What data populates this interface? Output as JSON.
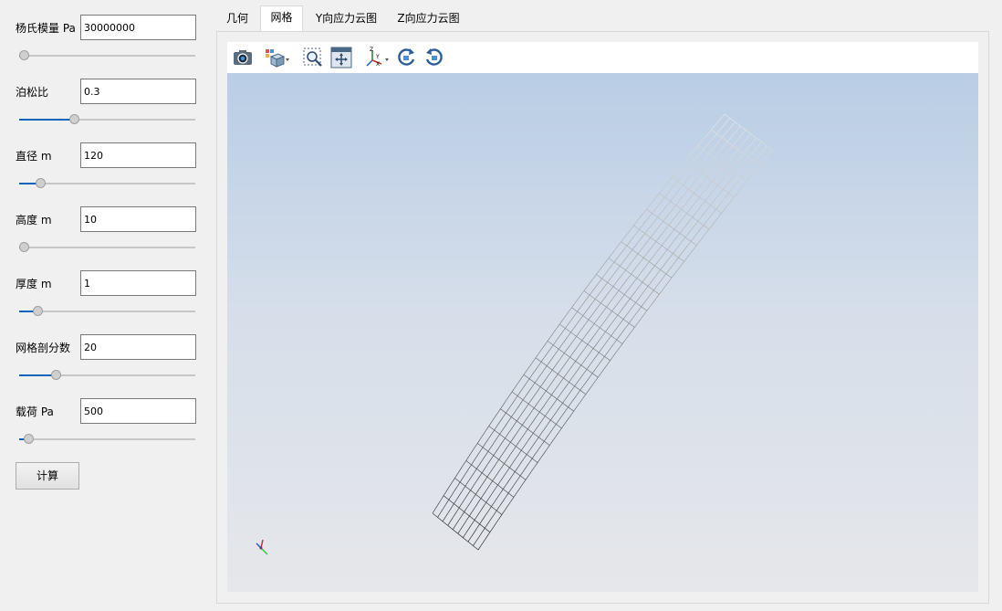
{
  "params": [
    {
      "label": "杨氏模量 Pa",
      "value": "30000000",
      "slider_fraction": 0.0
    },
    {
      "label": "泊松比",
      "value": "0.3",
      "slider_fraction": 0.3
    },
    {
      "label": "直径 m",
      "value": "120",
      "slider_fraction": 0.1
    },
    {
      "label": "高度 m",
      "value": "10",
      "slider_fraction": 0.0
    },
    {
      "label": "厚度 m",
      "value": "1",
      "slider_fraction": 0.08
    },
    {
      "label": "网格剖分数",
      "value": "20",
      "slider_fraction": 0.19
    },
    {
      "label": "载荷 Pa",
      "value": "500",
      "slider_fraction": 0.03
    }
  ],
  "calc_button": "计算",
  "tabs": [
    {
      "label": "几何",
      "active": false
    },
    {
      "label": "网格",
      "active": true
    },
    {
      "label": "Y向应力云图",
      "active": false
    },
    {
      "label": "Z向应力云图",
      "active": false
    }
  ],
  "toolbar": {
    "icons": [
      "camera-icon",
      "view-cube-icon",
      "zoom-window-icon",
      "fit-all-icon",
      "axes-triad-icon",
      "rotate-cw-icon",
      "rotate-ccw-icon"
    ]
  },
  "viewport": {
    "background_top": "#b9cde5",
    "background_bottom": "#e6e7ea",
    "axis_labels": [
      "Z",
      "Y",
      "X"
    ]
  },
  "colors": {
    "slider_fill": "#0a64b8",
    "mesh_dark": "#2a2a2a",
    "mesh_light": "#e8e8e8"
  }
}
